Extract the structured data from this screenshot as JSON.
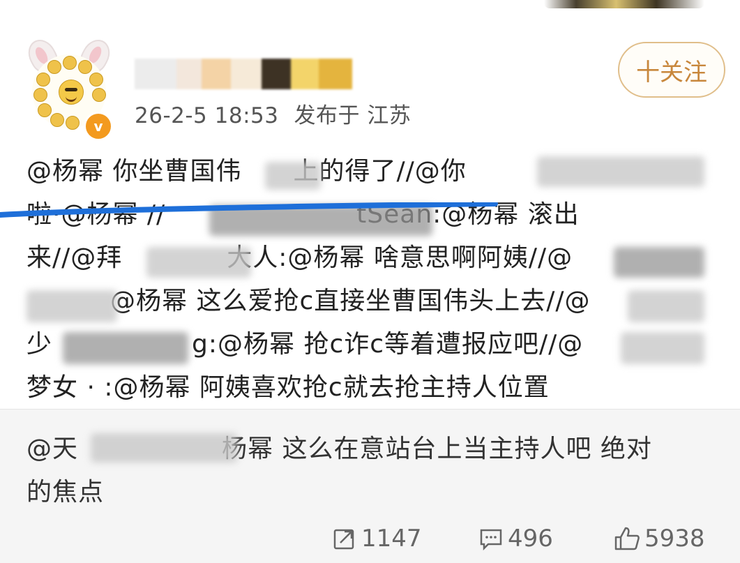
{
  "post": {
    "meta": {
      "date": "26-2-5 18:53",
      "location": "发布于 江苏"
    },
    "follow_label": "十关注",
    "avatar_badge": "v",
    "repost_lines": [
      "@杨幂 你坐曹国伟",
      "上的得了//@你",
      "啦·@杨幂 //",
      "tSean:@杨幂 滚出",
      "来//@拜",
      "大人:@杨幂 啥意思啊阿姨//@",
      "@杨幂 这么爱抢c直接坐曹国伟头上去//@",
      "少",
      "g:@杨幂 抢c诈c等着遭报应吧//@",
      "梦女 · :@杨幂 阿姨喜欢抢c就去抢主持人位置"
    ],
    "original_lines": [
      "@天",
      "杨幂 这么在意站台上当主持人吧 绝对",
      "的焦点"
    ],
    "actions": {
      "repost_count": "1147",
      "comment_count": "496",
      "like_count": "5938"
    }
  },
  "colors": {
    "follow_border": "#e0be8a",
    "follow_text": "#c8873c",
    "badge_orange": "#f39a1f",
    "blue_underline": "#1e6fd9",
    "original_bg": "#f5f5f5"
  },
  "icons": [
    "repost-icon",
    "comment-icon",
    "like-icon",
    "verified-badge-icon"
  ]
}
